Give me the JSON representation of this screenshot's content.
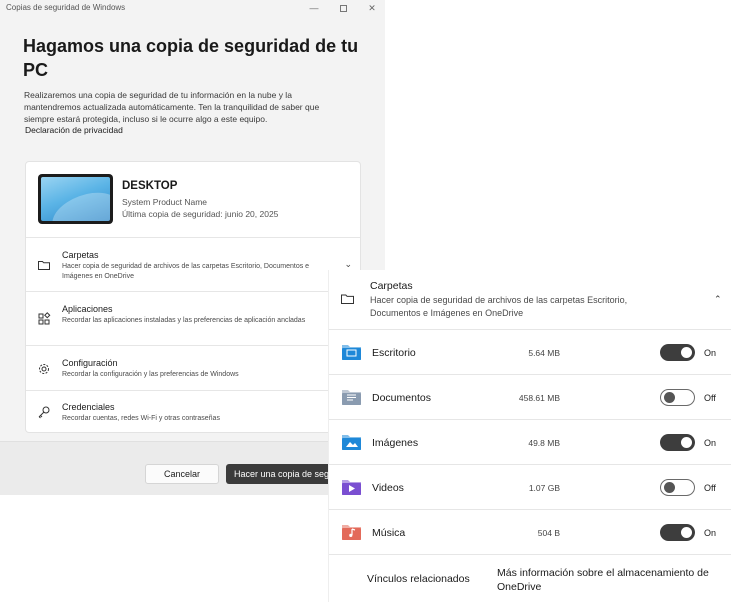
{
  "window": {
    "title": "Copias de seguridad de Windows",
    "controls": {
      "minimize": "—",
      "close": "✕"
    }
  },
  "page": {
    "heading": "Hagamos una copia de seguridad de tu PC",
    "description": "Realizaremos una copia de seguridad de tu información en la nube y la mantendremos actualizada automáticamente. Ten la tranquilidad de saber que siempre estará protegida, incluso si le ocurre algo a este equipo.",
    "privacy_link": "Declaración de privacidad"
  },
  "device": {
    "name": "DESKTOP",
    "model": "System Product Name",
    "last_backup": "Última copia de seguridad: junio 20, 2025"
  },
  "categories": [
    {
      "icon": "folder-icon",
      "title": "Carpetas",
      "subtitle": "Hacer copia de seguridad de archivos de las carpetas Escritorio, Documentos e Imágenes en OneDrive",
      "chevron": "⌄"
    },
    {
      "icon": "apps-icon",
      "title": "Aplicaciones",
      "subtitle": "Recordar las aplicaciones instaladas y las preferencias de aplicación ancladas"
    },
    {
      "icon": "gear-icon",
      "title": "Configuración",
      "subtitle": "Recordar la configuración y las preferencias de Windows"
    },
    {
      "icon": "key-icon",
      "title": "Credenciales",
      "subtitle": "Recordar cuentas, redes Wi-Fi y otras contraseñas"
    }
  ],
  "footer": {
    "cancel_label": "Cancelar",
    "primary_label": "Hacer una copia de seguridad"
  },
  "panel": {
    "title": "Carpetas",
    "subtitle": "Hacer copia de seguridad de archivos de las carpetas Escritorio, Documentos e Imágenes en OneDrive",
    "chevron": "⌃",
    "folders": [
      {
        "name": "Escritorio",
        "size": "5.64 MB",
        "on": true,
        "state_label": "On",
        "icon": "desktop-folder-icon",
        "color": "#1e88d8"
      },
      {
        "name": "Documentos",
        "size": "458.61 MB",
        "on": false,
        "state_label": "Off",
        "icon": "documents-folder-icon",
        "color": "#8a9bb0"
      },
      {
        "name": "Imágenes",
        "size": "49.8 MB",
        "on": true,
        "state_label": "On",
        "icon": "pictures-folder-icon",
        "color": "#1e88d8"
      },
      {
        "name": "Videos",
        "size": "1.07 GB",
        "on": false,
        "state_label": "Off",
        "icon": "videos-folder-icon",
        "color": "#7a4fd1"
      },
      {
        "name": "Música",
        "size": "504 B",
        "on": true,
        "state_label": "On",
        "icon": "music-folder-icon",
        "color": "#e36a5a"
      }
    ],
    "related_links_label": "Vínculos relacionados",
    "related_link": "Más información sobre el almacenamiento de OneDrive"
  }
}
